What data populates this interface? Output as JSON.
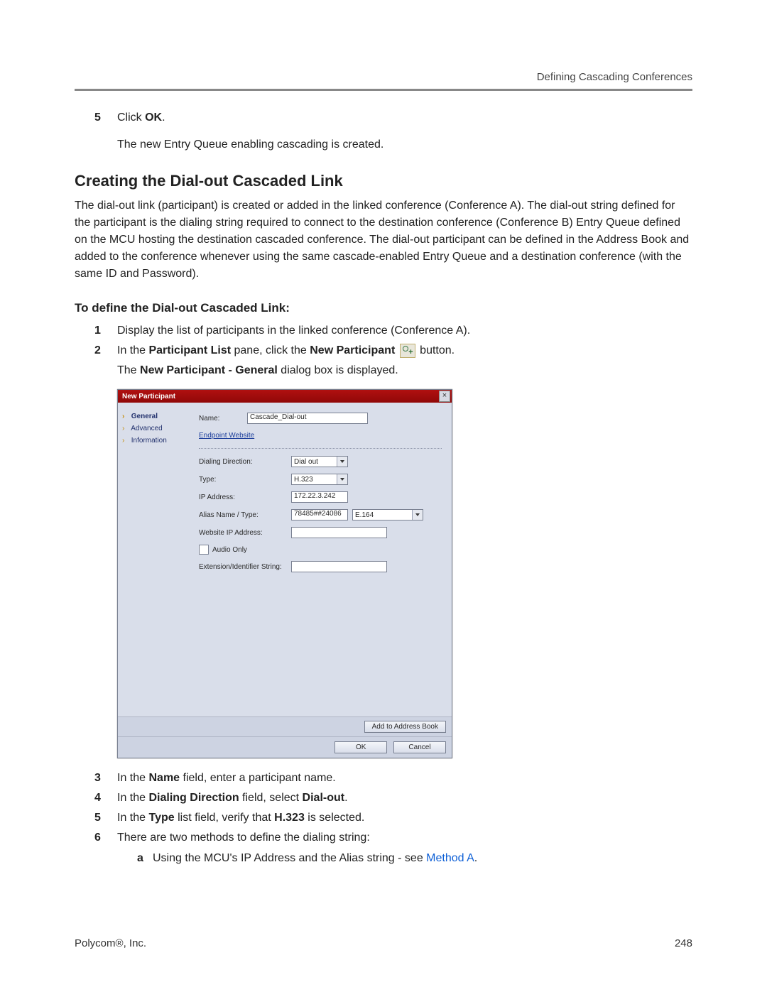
{
  "header": "Defining Cascading Conferences",
  "top_steps": [
    {
      "num": "5",
      "parts": [
        "Click ",
        {
          "b": "OK"
        },
        "."
      ]
    }
  ],
  "post_step_text": "The new Entry Queue enabling cascading is created.",
  "section_title": "Creating the Dial-out Cascaded Link",
  "section_body": "The dial-out link (participant) is created or added in the linked conference (Conference A). The dial-out string defined for the participant is the dialing string required to connect to the destination conference (Conference B) Entry Queue defined on the MCU hosting the destination cascaded conference. The dial-out participant can be defined in the Address Book and added to the conference whenever using the same cascade-enabled Entry Queue and a destination conference (with the same ID and Password).",
  "sub_heading": "To define the Dial-out Cascaded Link:",
  "steps2": [
    {
      "num": "1",
      "parts": [
        "Display the list of participants in the linked conference (Conference A)."
      ]
    },
    {
      "num": "2",
      "parts": [
        "In the ",
        {
          "b": "Participant List"
        },
        " pane, click the ",
        {
          "b": "New Participant"
        },
        " ",
        {
          "icon": true
        },
        " button."
      ],
      "after": [
        "The ",
        {
          "b": "New Participant - General"
        },
        " dialog box is displayed."
      ]
    }
  ],
  "dialog": {
    "title": "New Participant",
    "nav": [
      {
        "label": "General",
        "active": true
      },
      {
        "label": "Advanced"
      },
      {
        "label": "Information"
      }
    ],
    "name_label": "Name:",
    "name_value": "Cascade_Dial-out",
    "endpoint_link": "Endpoint Website",
    "dialing_direction_label": "Dialing Direction:",
    "dialing_direction_value": "Dial out",
    "type_label": "Type:",
    "type_value": "H.323",
    "ip_label": "IP Address:",
    "ip_value": "172.22.3.242",
    "alias_label": "Alias Name / Type:",
    "alias_value": "78485##24086",
    "alias_type": "E.164",
    "website_ip_label": "Website IP Address:",
    "website_ip_value": "",
    "audio_only_label": "Audio Only",
    "ext_label": "Extension/Identifier String:",
    "ext_value": "",
    "add_to_ab": "Add to Address Book",
    "ok": "OK",
    "cancel": "Cancel"
  },
  "steps3": [
    {
      "num": "3",
      "parts": [
        "In the ",
        {
          "b": "Name"
        },
        " field, enter a participant name."
      ]
    },
    {
      "num": "4",
      "parts": [
        "In the ",
        {
          "b": "Dialing Direction"
        },
        " field, select ",
        {
          "b": "Dial-out"
        },
        "."
      ]
    },
    {
      "num": "5",
      "parts": [
        "In the ",
        {
          "b": "Type"
        },
        " list field, verify that ",
        {
          "b": "H.323"
        },
        " is selected."
      ]
    },
    {
      "num": "6",
      "parts": [
        "There are two methods to define the dialing string:"
      ],
      "sub": [
        {
          "num": "a",
          "parts": [
            "Using the MCU's IP Address and the Alias string - see ",
            {
              "link": "Method A"
            },
            "."
          ]
        }
      ]
    }
  ],
  "footer": {
    "left": "Polycom®, Inc.",
    "right": "248"
  }
}
